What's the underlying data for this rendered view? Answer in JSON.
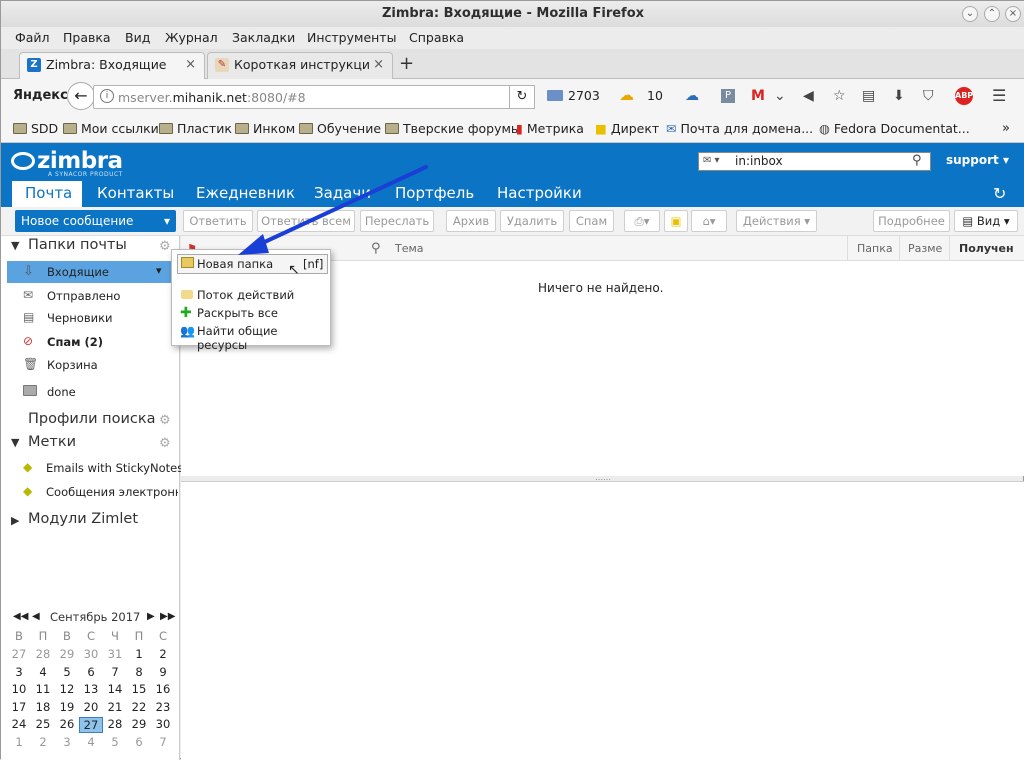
{
  "window": {
    "title": "Zimbra: Входящие - Mozilla Firefox"
  },
  "menubar": [
    "Файл",
    "Правка",
    "Вид",
    "Журнал",
    "Закладки",
    "Инструменты",
    "Справка"
  ],
  "tabs": [
    {
      "label": "Zimbra: Входящие",
      "close": "×"
    },
    {
      "label": "Короткая инструкция",
      "close": "×"
    }
  ],
  "newtab": "+",
  "navbar": {
    "yandex": "Яндекс",
    "url_prefix": "mserver.",
    "url_domain": "mihanik.net",
    "url_suffix": ":8080/#8",
    "mail_count": "2703",
    "weather": "10"
  },
  "bookmarks": [
    "SDD",
    "Мои ссылки",
    "Пластик",
    "Инком",
    "Обучение",
    "Тверские форумы",
    "Метрика",
    "Директ",
    "Почта для домена...",
    "Fedora Documentat..."
  ],
  "zimbra": {
    "logo": "zimbra",
    "logo_sub": "A SYNACOR PRODUCT",
    "search_value": "in:inbox",
    "user": "support",
    "app_tabs": [
      "Почта",
      "Контакты",
      "Ежедневник",
      "Задачи",
      "Портфель",
      "Настройки"
    ],
    "toolbar": {
      "new_message": "Новое сообщение",
      "reply": "Ответить",
      "reply_all": "Ответить всем",
      "forward": "Переслать",
      "archive": "Архив",
      "delete": "Удалить",
      "spam": "Спам",
      "actions": "Действия",
      "details": "Подробнее",
      "view": "Вид"
    },
    "sidebar": {
      "mail_folders": "Папки почты",
      "folders": [
        {
          "label": "Входящие"
        },
        {
          "label": "Отправлено"
        },
        {
          "label": "Черновики"
        },
        {
          "label": "Спам (2)"
        },
        {
          "label": "Корзина"
        },
        {
          "label": "done"
        }
      ],
      "search_profiles": "Профили поиска",
      "tags_header": "Метки",
      "tags": [
        "Emails with StickyNotes",
        "Сообщения электронно"
      ],
      "zimlets": "Модули Zimlet"
    },
    "list_columns": {
      "subject": "Тема",
      "folder": "Папка",
      "size": "Разме",
      "received": "Получен"
    },
    "empty_message": "Ничего не найдено.",
    "calendar": {
      "month": "Сентябрь 2017",
      "weekdays": [
        "В",
        "П",
        "В",
        "С",
        "Ч",
        "П",
        "С"
      ],
      "weeks": [
        [
          "27",
          "28",
          "29",
          "30",
          "31",
          "1",
          "2"
        ],
        [
          "3",
          "4",
          "5",
          "6",
          "7",
          "8",
          "9"
        ],
        [
          "10",
          "11",
          "12",
          "13",
          "14",
          "15",
          "16"
        ],
        [
          "17",
          "18",
          "19",
          "20",
          "21",
          "22",
          "23"
        ],
        [
          "24",
          "25",
          "26",
          "27",
          "28",
          "29",
          "30"
        ],
        [
          "1",
          "2",
          "3",
          "4",
          "5",
          "6",
          "7"
        ]
      ],
      "today": "27"
    },
    "popup": {
      "new_folder": "Новая папка",
      "shortcut": "[nf]",
      "activity_stream": "Поток действий",
      "expand_all": "Раскрыть все",
      "find_shares": "Найти общие ресурсы"
    }
  },
  "colors": {
    "zimbra_blue": "#0b74c4",
    "annotation_arrow": "#1a3fd6"
  }
}
